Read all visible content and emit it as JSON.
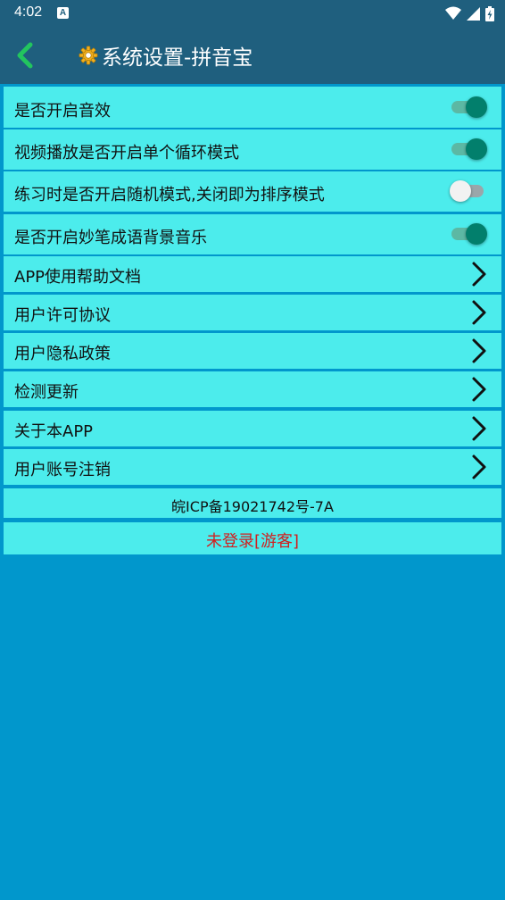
{
  "status_bar": {
    "time": "4:02",
    "notification_icon": "A"
  },
  "header": {
    "back_icon": "chevron-left-icon",
    "title_icon": "gear-icon",
    "title": "系统设置-拼音宝"
  },
  "toggles": [
    {
      "label": "是否开启音效",
      "on": true
    },
    {
      "label": "视频播放是否开启单个循环模式",
      "on": true
    },
    {
      "label": "练习时是否开启随机模式,关闭即为排序模式",
      "on": false
    },
    {
      "label": "是否开启妙笔成语背景音乐",
      "on": true
    }
  ],
  "links": [
    {
      "label": "APP使用帮助文档"
    },
    {
      "label": "用户许可协议"
    },
    {
      "label": "用户隐私政策"
    },
    {
      "label": "检测更新"
    },
    {
      "label": "关于本APP"
    },
    {
      "label": "用户账号注销"
    }
  ],
  "footer": {
    "icp": "皖ICP备19021742号-7A",
    "login_status": "未登录[游客]"
  },
  "colors": {
    "background": "#0197cc",
    "header": "#1f5f7e",
    "row": "#4cecec",
    "accent_back": "#22c55e",
    "toggle_on": "#027f6c",
    "login_status": "#d11f1f"
  }
}
